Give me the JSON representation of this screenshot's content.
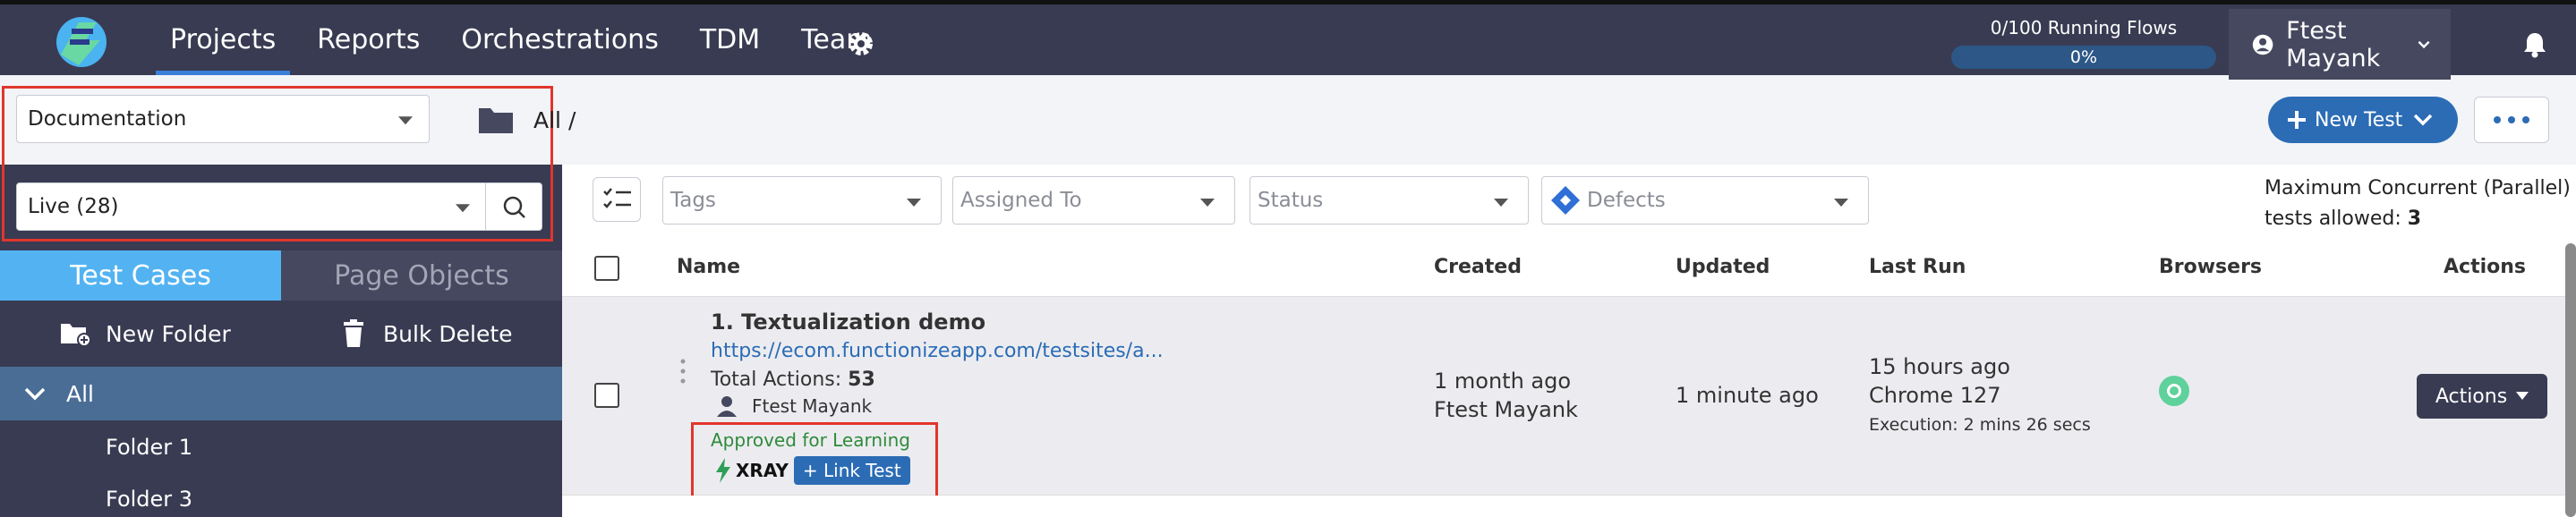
{
  "nav": {
    "items": [
      "Projects",
      "Reports",
      "Orchestrations",
      "TDM",
      "Team"
    ],
    "active": "Projects"
  },
  "flows": {
    "label": "0/100 Running Flows",
    "percent": "0%"
  },
  "user": {
    "name": "Ftest Mayank"
  },
  "project_select": {
    "value": "Documentation"
  },
  "status_select": {
    "value": "Live (28)"
  },
  "tabs": {
    "test_cases": "Test Cases",
    "page_objects": "Page Objects"
  },
  "tools": {
    "new_folder": "New Folder",
    "bulk_delete": "Bulk Delete"
  },
  "tree": {
    "all": "All",
    "folders": [
      "Folder 1",
      "Folder 3"
    ]
  },
  "breadcrumb": {
    "path": "All /"
  },
  "buttons": {
    "new_test": "New Test",
    "actions": "Actions"
  },
  "filters": {
    "tags": "Tags",
    "assigned_to": "Assigned To",
    "status": "Status",
    "defects": "Defects"
  },
  "max_concurrent": {
    "line1": "Maximum Concurrent (Parallel)",
    "line2_prefix": "tests allowed:",
    "value": "3"
  },
  "table": {
    "headers": {
      "name": "Name",
      "created": "Created",
      "updated": "Updated",
      "last_run": "Last Run",
      "browsers": "Browsers",
      "actions": "Actions"
    },
    "row": {
      "title": "1. Textualization demo",
      "url": "https://ecom.functionizeapp.com/testsites/a...",
      "total_actions_label": "Total Actions:",
      "total_actions": "53",
      "owner": "Ftest Mayank",
      "approval": "Approved for Learning",
      "xray_label": "XRAY",
      "link_test": "+ Link Test",
      "created_ago": "1 month ago",
      "created_by": "Ftest Mayank",
      "updated": "1 minute ago",
      "last_run_ago": "15 hours ago",
      "last_run_browser": "Chrome 127",
      "execution": "Execution: 2 mins 26 secs"
    }
  },
  "colors": {
    "nav_bg": "#393b52",
    "accent": "#2b6cb5",
    "tab_active": "#53b3f2",
    "highlight": "#e0362c"
  }
}
